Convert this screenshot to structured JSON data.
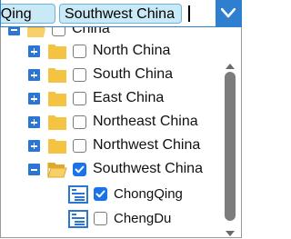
{
  "input": {
    "tags": [
      "ngQing",
      "Southwest China"
    ]
  },
  "tree": {
    "root_label": "China",
    "regions": [
      {
        "label": "North China",
        "checked": false,
        "expanded": false
      },
      {
        "label": "South China",
        "checked": false,
        "expanded": false
      },
      {
        "label": "East China",
        "checked": false,
        "expanded": false
      },
      {
        "label": "Northeast China",
        "checked": false,
        "expanded": false
      },
      {
        "label": "Northwest China",
        "checked": false,
        "expanded": false
      },
      {
        "label": "Southwest China",
        "checked": true,
        "expanded": true
      }
    ],
    "cities": [
      {
        "label": "ChongQing",
        "checked": true
      },
      {
        "label": "ChengDu",
        "checked": false
      }
    ]
  },
  "colors": {
    "accent": "#2e7fcf",
    "tag_bg": "#c9e9f6",
    "folder": "#f5c342",
    "checkbox_checked": "#1a73e8"
  }
}
